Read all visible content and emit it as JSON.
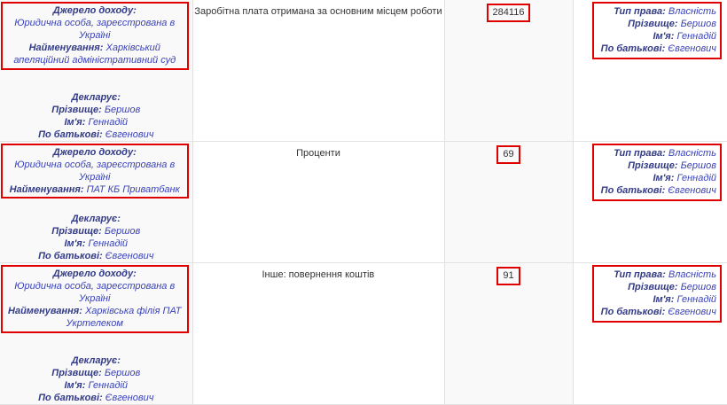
{
  "labels": {
    "source": "Джерело доходу:",
    "name": "Найменування:",
    "declarant": "Декларує:",
    "surname": "Прізвище:",
    "first_name": "Ім'я:",
    "patronymic": "По батькові:",
    "right_type": "Тип права:"
  },
  "rows": [
    {
      "source_type": "Юридична особа, зареєстрована в Україні",
      "source_name": "Харківський апеляційний адміністративний суд",
      "declarant": {
        "surname": "Бершов",
        "first_name": "Геннадій",
        "patronymic": "Євгенович"
      },
      "income_type": "Заробітна плата отримана за основним місцем роботи",
      "amount": "284116",
      "owner": {
        "right_type": "Власність",
        "surname": "Бершов",
        "first_name": "Геннадій",
        "patronymic": "Євгенович"
      }
    },
    {
      "source_type": "Юридична особа, зареєстрована в Україні",
      "source_name": "ПАТ КБ Приватбанк",
      "declarant": {
        "surname": "Бершов",
        "first_name": "Геннадій",
        "patronymic": "Євгенович"
      },
      "income_type": "Проценти",
      "amount": "69",
      "owner": {
        "right_type": "Власність",
        "surname": "Бершов",
        "first_name": "Геннадій",
        "patronymic": "Євгенович"
      }
    },
    {
      "source_type": "Юридична особа, зареєстрована в Україні",
      "source_name": "Харківська філія ПАТ Укртелеком",
      "declarant": {
        "surname": "Бершов",
        "first_name": "Геннадій",
        "patronymic": "Євгенович"
      },
      "income_type": "Інше: повернення коштів",
      "amount": "91",
      "owner": {
        "right_type": "Власність",
        "surname": "Бершов",
        "first_name": "Геннадій",
        "patronymic": "Євгенович"
      }
    }
  ]
}
